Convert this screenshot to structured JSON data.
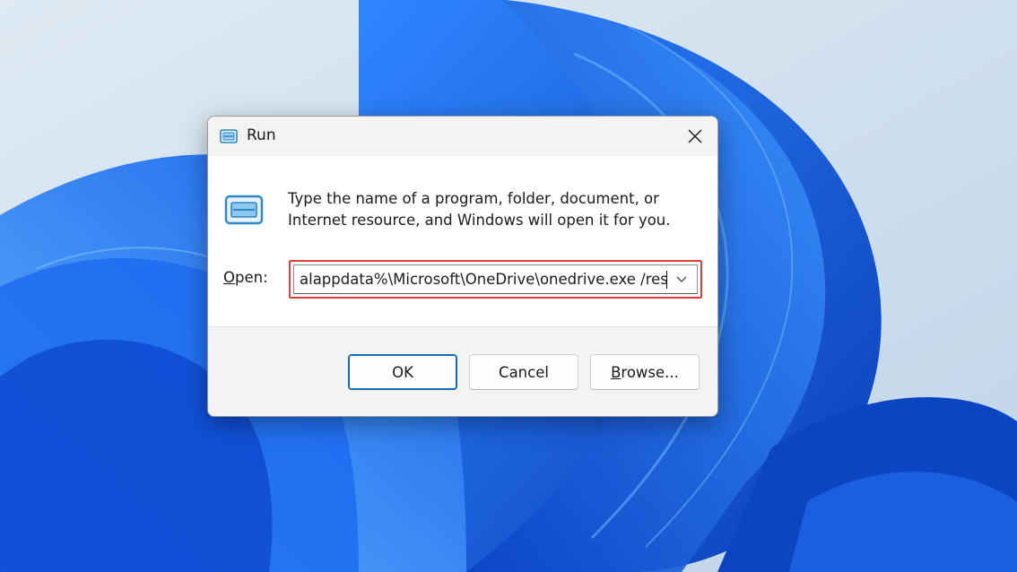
{
  "dialog": {
    "title": "Run",
    "description": "Type the name of a program, folder, document, or Internet resource, and Windows will open it for you.",
    "open_label_key": "O",
    "open_label_rest": "pen:",
    "command_value": "alappdata%\\Microsoft\\OneDrive\\onedrive.exe /reset",
    "buttons": {
      "ok": "OK",
      "cancel": "Cancel",
      "browse_key": "B",
      "browse_rest": "rowse..."
    }
  },
  "colors": {
    "accent": "#0f6cbd",
    "highlight_border": "#e43b3b",
    "wallpaper_blue": "#1a5fe0"
  },
  "icons": {
    "title": "run-app-icon",
    "content": "run-app-icon-large",
    "close": "close-icon",
    "dropdown": "chevron-down-icon"
  }
}
